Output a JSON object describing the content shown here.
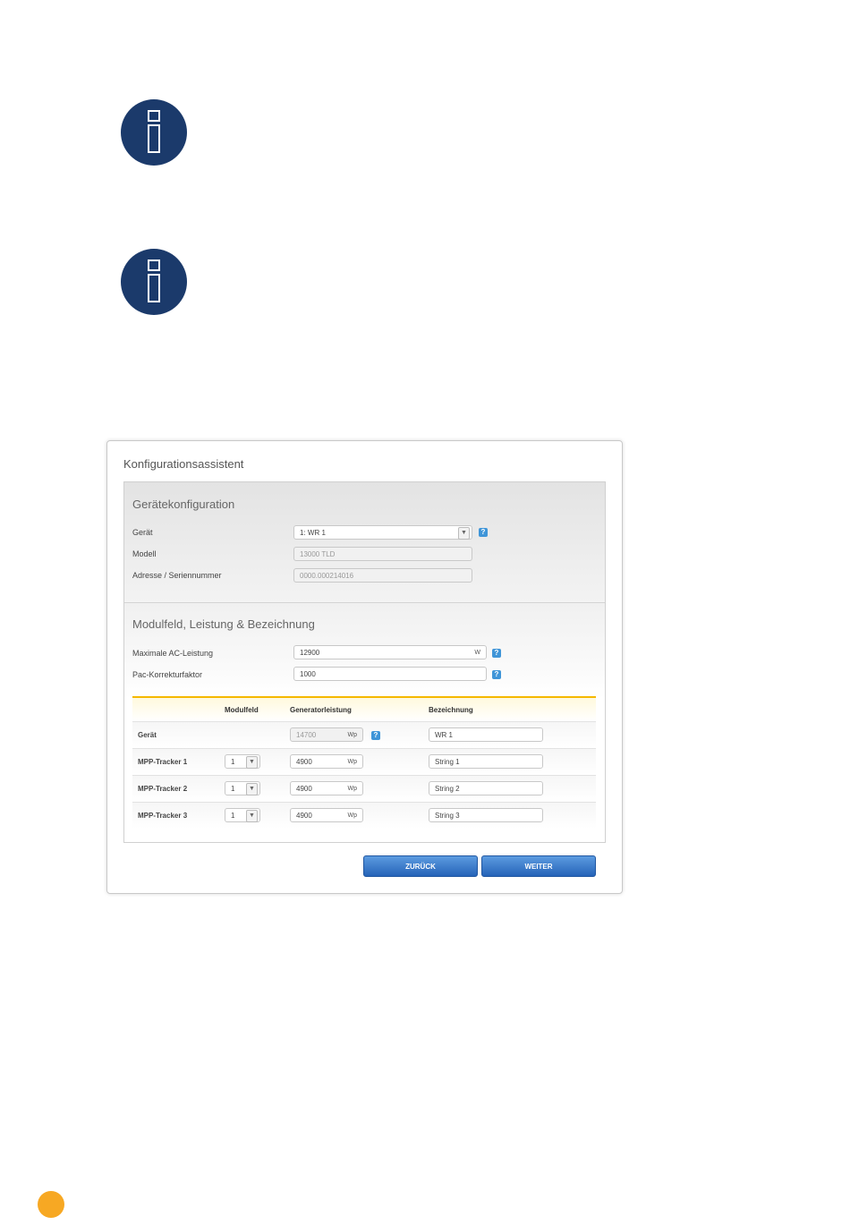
{
  "wizard": {
    "title": "Konfigurationsassistent",
    "device_config": {
      "title": "Gerätekonfiguration",
      "device_label": "Gerät",
      "device_value": "1: WR 1",
      "model_label": "Modell",
      "model_value": "13000 TLD",
      "address_label": "Adresse / Seriennummer",
      "address_value": "0000.000214016"
    },
    "module_config": {
      "title": "Modulfeld, Leistung & Bezeichnung",
      "max_ac_label": "Maximale AC-Leistung",
      "max_ac_value": "12900",
      "max_ac_unit": "W",
      "pac_label": "Pac-Korrekturfaktor",
      "pac_value": "1000"
    },
    "table": {
      "headers": [
        "Modulfeld",
        "Generatorleistung",
        "Bezeichnung"
      ],
      "rows": [
        {
          "label": "Gerät",
          "modulfeld": "",
          "power": "14700",
          "unit": "Wp",
          "name": "WR 1"
        },
        {
          "label": "MPP-Tracker 1",
          "modulfeld": "1",
          "power": "4900",
          "unit": "Wp",
          "name": "String 1"
        },
        {
          "label": "MPP-Tracker 2",
          "modulfeld": "1",
          "power": "4900",
          "unit": "Wp",
          "name": "String 2"
        },
        {
          "label": "MPP-Tracker 3",
          "modulfeld": "1",
          "power": "4900",
          "unit": "Wp",
          "name": "String 3"
        }
      ]
    },
    "buttons": {
      "back": "ZURÜCK",
      "next": "WEITER"
    },
    "help_glyph": "?"
  },
  "icons": [
    "info-icon",
    "info-icon"
  ],
  "colors": {
    "info_icon": "#1b3a6b",
    "accent": "#f5b800",
    "button": "#2563b8",
    "page_dot": "#f7a823"
  }
}
